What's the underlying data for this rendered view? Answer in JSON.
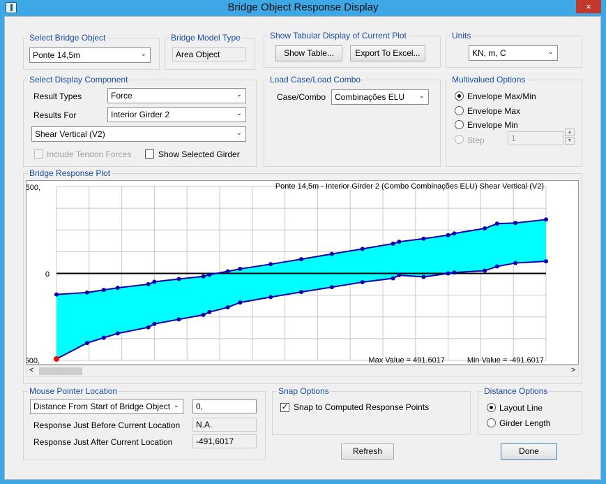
{
  "window": {
    "title": "Bridge Object Response Display",
    "close_icon": "×"
  },
  "select_bridge_object": {
    "label": "Select Bridge Object",
    "value": "Ponte 14,5m"
  },
  "bridge_model_type": {
    "label": "Bridge Model Type",
    "value": "Area Object"
  },
  "tabular": {
    "label": "Show Tabular Display of Current Plot",
    "show_table": "Show Table...",
    "export_excel": "Export To Excel..."
  },
  "units": {
    "label": "Units",
    "value": "KN, m, C"
  },
  "display_component": {
    "label": "Select Display Component",
    "result_types_label": "Result Types",
    "result_types_value": "Force",
    "results_for_label": "Results For",
    "results_for_value": "Interior Girder 2",
    "component_value": "Shear Vertical  (V2)",
    "include_tendon": "Include Tendon Forces",
    "show_selected_girder": "Show Selected Girder"
  },
  "load_case": {
    "label": "Load Case/Load Combo",
    "case_label": "Case/Combo",
    "case_value": "Combinações ELU"
  },
  "multivalued": {
    "label": "Multivalued Options",
    "opt1": "Envelope Max/Min",
    "opt2": "Envelope Max",
    "opt3": "Envelope Min",
    "opt4": "Step",
    "step_value": "1"
  },
  "plot": {
    "label": "Bridge Response Plot",
    "header": "Ponte 14,5m - Interior Girder 2   (Combo Combinações ELU)   Shear Vertical  (V2)",
    "max_text": "Max Value = 491.6017",
    "min_text": "Min Value = -491.6017",
    "y_top": "500,",
    "y_zero": "0",
    "y_bottom": "-500,",
    "scroll_left": "<",
    "scroll_right": ">"
  },
  "chart_data": {
    "type": "area",
    "title": "Ponte 14,5m - Interior Girder 2   (Combo Combinações ELU)   Shear Vertical  (V2)",
    "ylim": [
      -500,
      500
    ],
    "xlim": [
      0,
      14.5
    ],
    "series": [
      {
        "name": "Max",
        "x": [
          0,
          0.906,
          1.4,
          1.813,
          2.719,
          2.9,
          3.625,
          4.35,
          4.531,
          5.075,
          5.438,
          6.344,
          7.25,
          8.156,
          9.063,
          9.969,
          10.15,
          10.875,
          11.6,
          11.781,
          12.688,
          13.05,
          13.594,
          14.5
        ],
        "values": [
          -121,
          -110,
          -95,
          -83,
          -62,
          -48,
          -32,
          -17,
          -7,
          12,
          26,
          53,
          82,
          112,
          141,
          171,
          182,
          200,
          220,
          230,
          259,
          286,
          290,
          310
        ]
      },
      {
        "name": "Min",
        "x": [
          0,
          0.906,
          1.4,
          1.813,
          2.719,
          2.9,
          3.625,
          4.35,
          4.531,
          5.075,
          5.438,
          6.344,
          7.25,
          8.156,
          9.063,
          9.969,
          10.15,
          10.875,
          11.6,
          11.781,
          12.688,
          13.05,
          13.594,
          14.5
        ],
        "values": [
          -491.6,
          -400,
          -370,
          -345,
          -310,
          -290,
          -264,
          -238,
          -222,
          -195,
          -167,
          -136,
          -107,
          -79,
          -50,
          -28,
          -10,
          -20,
          0,
          5,
          16,
          40,
          60,
          70
        ]
      }
    ],
    "max_value": 491.6017,
    "min_value": -491.6017,
    "grid": true
  },
  "mouse": {
    "label": "Mouse Pointer Location",
    "mode_value": "Distance From Start of Bridge Object",
    "distance_value": "0,",
    "before_label": "Response Just Before Current Location",
    "before_value": "N.A.",
    "after_label": "Response Just After Current Location",
    "after_value": "-491,6017"
  },
  "snap": {
    "label": "Snap Options",
    "snap_text": "Snap to Computed Response Points"
  },
  "distance_options": {
    "label": "Distance Options",
    "layout_line": "Layout Line",
    "girder_length": "Girder Length"
  },
  "buttons": {
    "refresh": "Refresh",
    "done": "Done"
  }
}
